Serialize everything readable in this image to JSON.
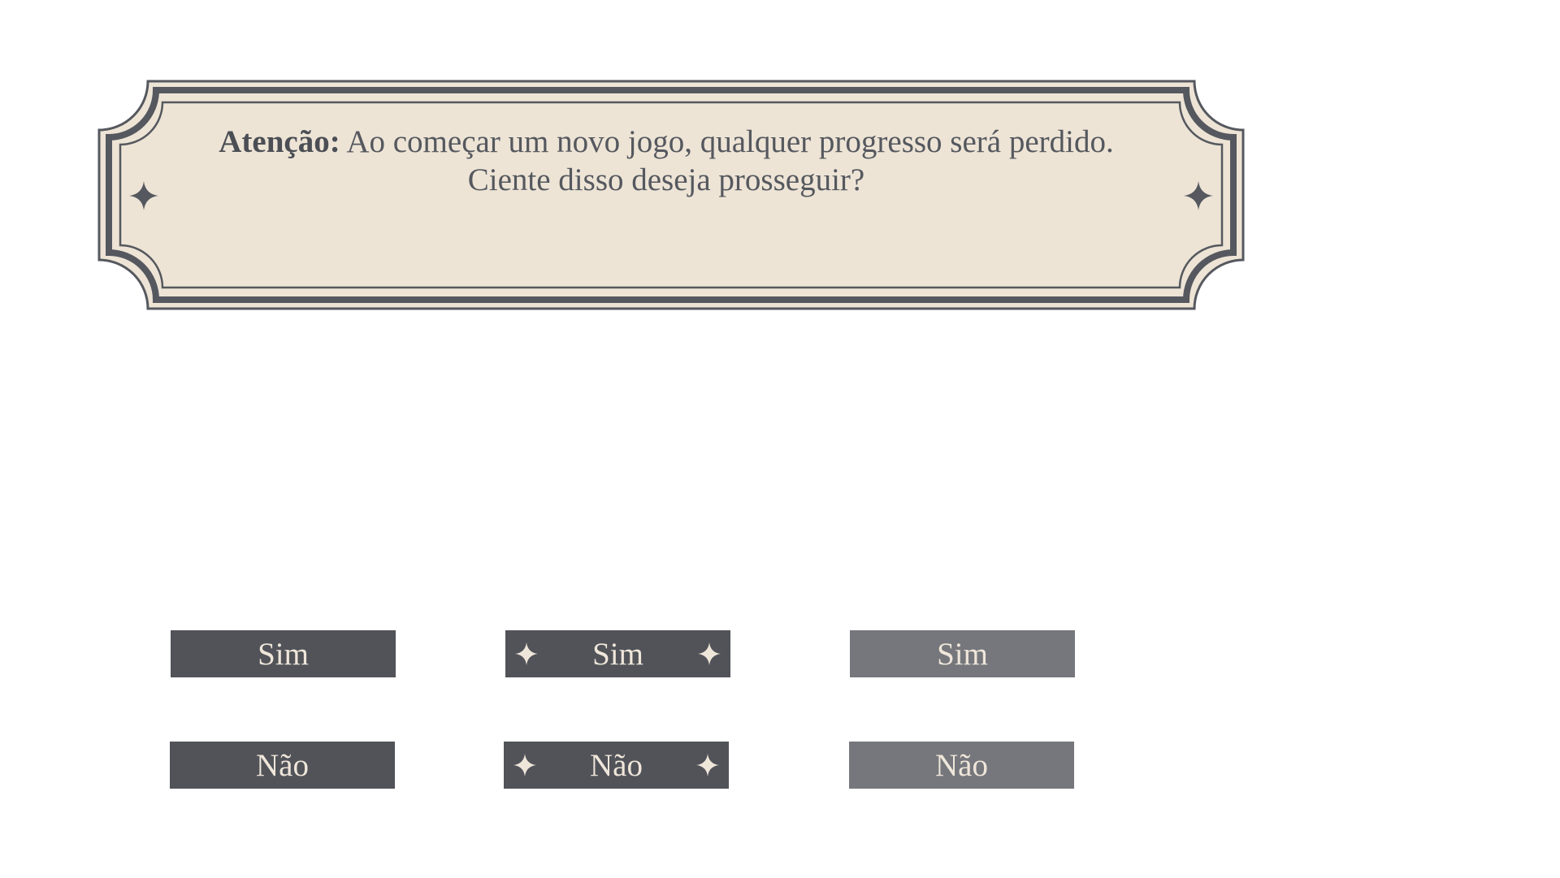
{
  "dialog": {
    "warning_label": "Atenção:",
    "message_line1": "Ao começar um novo jogo, qualquer progresso será perdido.",
    "message_line2": "Ciente disso deseja prosseguir?"
  },
  "buttons": {
    "normal": {
      "yes": "Sim",
      "no": "Não"
    },
    "hover": {
      "yes": "Sim",
      "no": "Não"
    },
    "disabled": {
      "yes": "Sim",
      "no": "Não"
    }
  },
  "colors": {
    "panel_fill": "#ede4d6",
    "frame_stroke": "#55585e",
    "button_dark": "#515359",
    "button_disabled": "#75777c",
    "button_text": "#efe6da"
  },
  "icons": {
    "ornament": "four-point-star-icon"
  }
}
